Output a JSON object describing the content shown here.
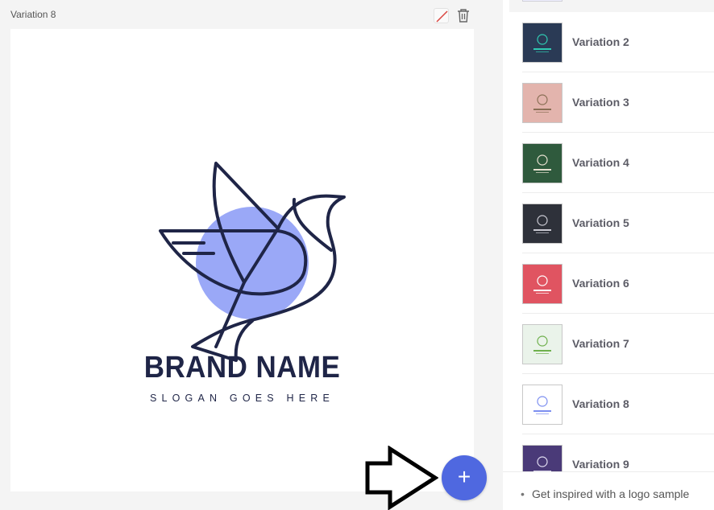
{
  "editor": {
    "variation_title": "Variation 8",
    "edit_icon": "slash-color-icon",
    "delete_icon": "trash-icon",
    "logo": {
      "brand_name": "BRAND NAME",
      "slogan": "SLOGAN GOES HERE",
      "icon": "dove-icon",
      "colors": {
        "line": "#1f2547",
        "circle": "#9aa8f7"
      }
    },
    "add_button_label": "+",
    "accent": "#4f68e0"
  },
  "sidebar": {
    "items": [
      {
        "label": "Variation 2",
        "thumb_bg": "#2a3a55",
        "thumb_fg": "#2fc9b1"
      },
      {
        "label": "Variation 3",
        "thumb_bg": "#e3b4ad",
        "thumb_fg": "#8a6f55"
      },
      {
        "label": "Variation 4",
        "thumb_bg": "#2f5a3d",
        "thumb_fg": "#e6e0d0"
      },
      {
        "label": "Variation 5",
        "thumb_bg": "#2e313a",
        "thumb_fg": "#c9c9d2"
      },
      {
        "label": "Variation 6",
        "thumb_bg": "#e05461",
        "thumb_fg": "#ffffff"
      },
      {
        "label": "Variation 7",
        "thumb_bg": "#eaf3ea",
        "thumb_fg": "#6fb04d"
      },
      {
        "label": "Variation 8",
        "thumb_bg": "#ffffff",
        "thumb_fg": "#7d8ff0"
      },
      {
        "label": "Variation 9",
        "thumb_bg": "#4a3a78",
        "thumb_fg": "#e0dcf0"
      }
    ],
    "footer_bullet": "•",
    "footer_text": "Get inspired with a logo sample"
  }
}
